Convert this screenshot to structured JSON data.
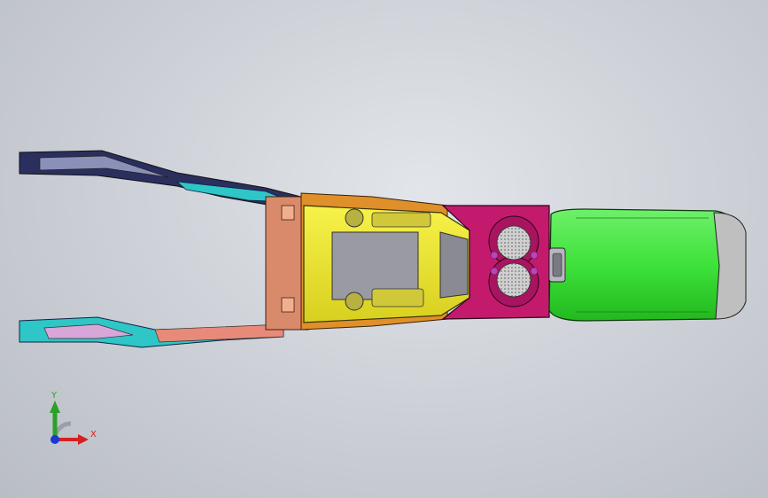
{
  "viewport": {
    "background": "#cdd1d7"
  },
  "model": {
    "parts": [
      {
        "name": "front-bracket-rail",
        "color": "#2ec6c6"
      },
      {
        "name": "mounting-bracket",
        "color": "#d98a6a"
      },
      {
        "name": "shifter-bezel",
        "color": "#f0f030"
      },
      {
        "name": "console-side-panel",
        "color": "#e0902a"
      },
      {
        "name": "cupholder-trim",
        "color": "#c41a6e"
      },
      {
        "name": "cupholder-mesh",
        "color": "#b8b8b8"
      },
      {
        "name": "armrest-lid",
        "color": "#3ee23a"
      },
      {
        "name": "rear-end-cap",
        "color": "#bfbfbf"
      }
    ]
  },
  "triad": {
    "y_label": "Y",
    "x_label": "X",
    "y_color": "#2aa02a",
    "x_color": "#d42020",
    "z_color": "#1a36d6"
  }
}
